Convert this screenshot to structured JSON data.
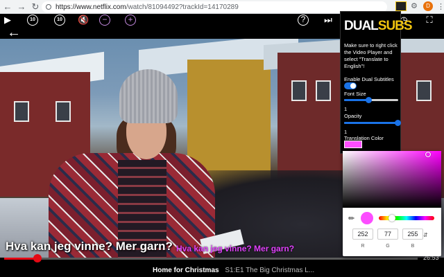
{
  "browser": {
    "url_host": "https://www.netflix.com",
    "url_path": "/watch/81094492?trackId=14170289",
    "avatar_letter": "D"
  },
  "player": {
    "subtitle_original": "Hva kan jeg vinne? Mer garn?",
    "subtitle_translation": "Hva kan jeg vinne? Mer garn?",
    "progress_fraction": 0.08,
    "time_remaining": "26:53",
    "title": "Home for Christmas",
    "episode": "S1:E1  The Big Christmas L..."
  },
  "controls": {
    "skip_back_label": "10",
    "skip_forward_label": "10"
  },
  "dualsubs": {
    "logo_dual": "DUAL",
    "logo_subs": "SUBS",
    "instruction": "Make sure to right click the Video Player and select \"Translate to English\"!",
    "enable_label": "Enable Dual Subtitles",
    "enabled": true,
    "font_size_label": "Font Size",
    "font_size_value": "1",
    "font_size_fraction": 0.45,
    "opacity_label": "Opacity",
    "opacity_value": "1",
    "opacity_fraction": 1.0,
    "translation_color_label": "Translation Color",
    "translation_color": "#fc4dff"
  },
  "color_picker": {
    "r": "252",
    "g": "77",
    "b": "255",
    "r_label": "R",
    "g_label": "G",
    "b_label": "B",
    "hue_fraction": 0.83,
    "sat_fraction": 0.7,
    "val_fraction": 0.99
  },
  "colors": {
    "netflix_red": "#e50914",
    "dualsubs_yellow": "#f1c40f",
    "translation_magenta": "#e040fb",
    "slider_blue": "#1a73e8"
  }
}
